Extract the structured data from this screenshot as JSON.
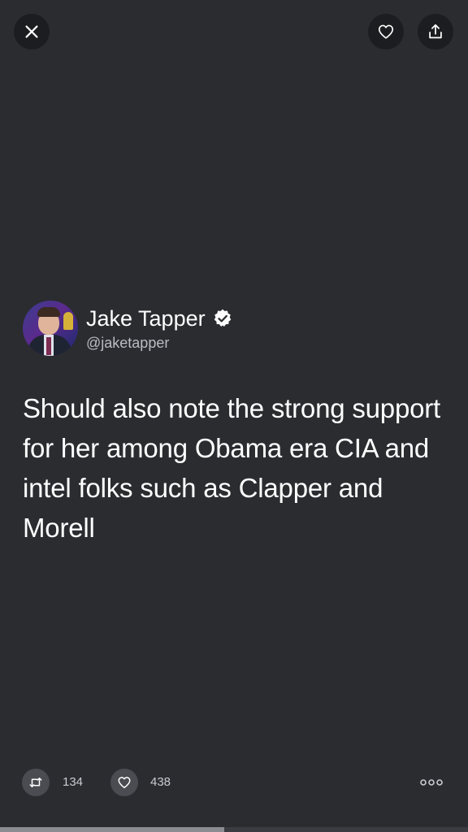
{
  "tweet": {
    "author": {
      "display_name": "Jake Tapper",
      "handle": "@jaketapper",
      "verified": true
    },
    "text": "Should also note the strong support for her among Obama era CIA and intel folks such as Clapper and Morell",
    "retweets": "134",
    "likes": "438"
  },
  "toolbar": {
    "close_icon": "close-icon",
    "like_icon": "heart-icon",
    "share_icon": "share-icon"
  },
  "viewer_progress": 0.48,
  "colors": {
    "background": "#2a2c30",
    "button_bg": "#1c1d20",
    "text_primary": "#ffffff",
    "text_secondary": "#b9bcc2"
  }
}
